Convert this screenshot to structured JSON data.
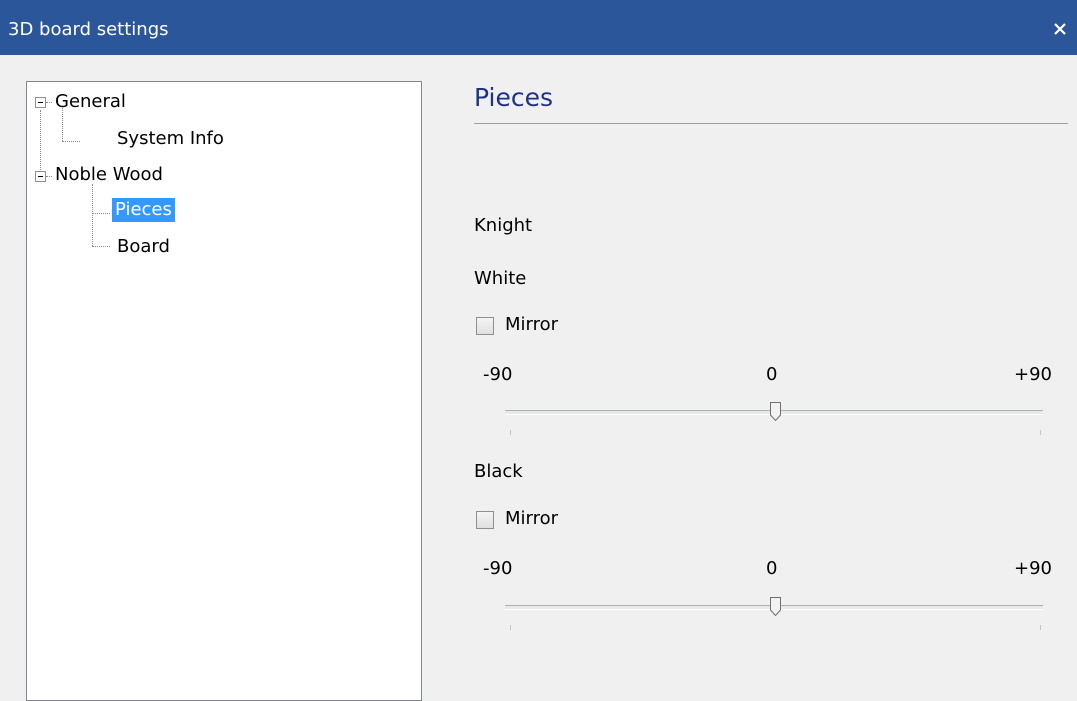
{
  "window": {
    "title": "3D board settings",
    "close_glyph": "✕"
  },
  "tree": {
    "nodes": [
      {
        "label": "General",
        "expanded": true
      },
      {
        "label": "System Info"
      },
      {
        "label": "Noble Wood",
        "expanded": true
      },
      {
        "label": "Pieces",
        "selected": true
      },
      {
        "label": "Board"
      }
    ]
  },
  "panel": {
    "title": "Pieces",
    "piece_label": "Knight",
    "white": {
      "label": "White",
      "mirror_label": "Mirror",
      "mirror_checked": false,
      "slider": {
        "min_label": "-90",
        "mid_label": "0",
        "max_label": "+90",
        "min": -90,
        "max": 90,
        "value": 0
      }
    },
    "black": {
      "label": "Black",
      "mirror_label": "Mirror",
      "mirror_checked": false,
      "slider": {
        "min_label": "-90",
        "mid_label": "0",
        "max_label": "+90",
        "min": -90,
        "max": 90,
        "value": 0
      }
    }
  },
  "colors": {
    "titlebar": "#2b579a",
    "selection": "#3399ff",
    "section_title": "#1e3287"
  }
}
